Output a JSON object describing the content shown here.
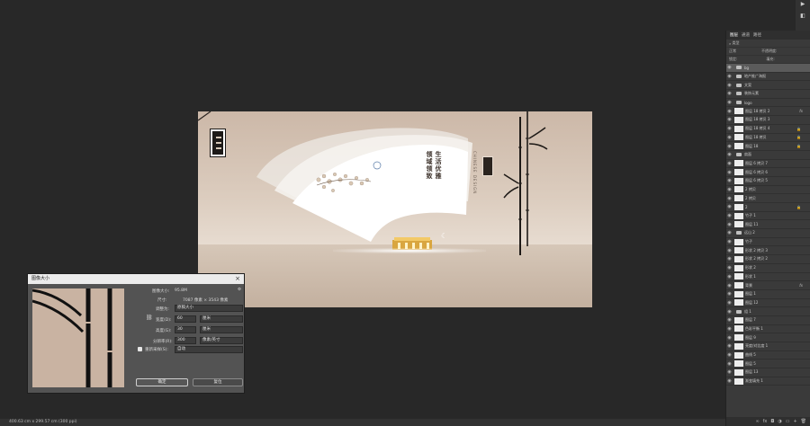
{
  "poster": {
    "seal_text": "华府",
    "headline": [
      "生活优雅",
      "领域领致"
    ],
    "side_text": "CHINESE DESIGN",
    "stamp_text": "府"
  },
  "dialog": {
    "title": "图像大小",
    "close": "×",
    "image_size_label": "图像大小:",
    "image_size_value": "95.8M",
    "dimensions_label": "尺寸:",
    "dimensions_value": "7087 像素 × 3543 像素",
    "fit_to_label": "调整为:",
    "fit_to_value": "原稿大小",
    "width_label": "宽度(D):",
    "width_value": "60",
    "width_unit": "厘米",
    "height_label": "高度(G):",
    "height_value": "30",
    "height_unit": "厘米",
    "resolution_label": "分辨率(R):",
    "resolution_value": "300",
    "resolution_unit": "像素/英寸",
    "resample_label": "重新采样(S):",
    "resample_value": "自动",
    "ok_label": "确定",
    "cancel_label": "复位"
  },
  "layers_panel": {
    "tabs": [
      "图层",
      "通道",
      "路径"
    ],
    "search_label": "类型",
    "blend_mode": "正常",
    "opacity_label": "不透明度:",
    "lock_label": "锁定:",
    "fill_label": "填充:",
    "layers": [
      {
        "name": "bg",
        "type": "folder",
        "sel": true
      },
      {
        "name": "地产推广海报",
        "type": "folder"
      },
      {
        "name": "文案",
        "type": "folder"
      },
      {
        "name": "装饰元素",
        "type": "folder"
      },
      {
        "name": "logo",
        "type": "folder"
      },
      {
        "name": "图层 18 拷贝 2",
        "type": "layer",
        "fx": true
      },
      {
        "name": "图层 18 拷贝 3",
        "type": "layer"
      },
      {
        "name": "图层 18 拷贝 4",
        "type": "layer",
        "lock": true
      },
      {
        "name": "图层 18 拷贝",
        "type": "layer",
        "lock": true
      },
      {
        "name": "图层 18",
        "type": "layer",
        "lock": true
      },
      {
        "name": "扇面",
        "type": "folder"
      },
      {
        "name": "图层 6 拷贝 7",
        "type": "layer"
      },
      {
        "name": "图层 6 拷贝 6",
        "type": "layer"
      },
      {
        "name": "图层 6 拷贝 5",
        "type": "layer"
      },
      {
        "name": "2 拷贝",
        "type": "layer"
      },
      {
        "name": "2 拷贝",
        "type": "layer"
      },
      {
        "name": "2",
        "type": "layer",
        "lock": true
      },
      {
        "name": "竹子 1",
        "type": "layer"
      },
      {
        "name": "图层 11",
        "type": "layer"
      },
      {
        "name": "远山 2",
        "type": "folder"
      },
      {
        "name": "竹子",
        "type": "layer"
      },
      {
        "name": "形状 2 拷贝 3",
        "type": "layer"
      },
      {
        "name": "形状 2 拷贝 2",
        "type": "layer"
      },
      {
        "name": "形状 2",
        "type": "layer"
      },
      {
        "name": "形状 1",
        "type": "layer"
      },
      {
        "name": "背景",
        "type": "layer",
        "fx": true
      },
      {
        "name": "图层 1",
        "type": "layer"
      },
      {
        "name": "图层 12",
        "type": "layer"
      },
      {
        "name": "组 1",
        "type": "folder"
      },
      {
        "name": "图层 7",
        "type": "layer"
      },
      {
        "name": "色彩平衡 1",
        "type": "layer"
      },
      {
        "name": "图层 9",
        "type": "layer"
      },
      {
        "name": "亮度/对比度 1",
        "type": "layer"
      },
      {
        "name": "曲线 5",
        "type": "layer"
      },
      {
        "name": "图层 5",
        "type": "layer"
      },
      {
        "name": "图层 13",
        "type": "layer"
      },
      {
        "name": "渐变填充 1",
        "type": "layer"
      }
    ]
  },
  "status_bar": {
    "text": "400.63 cm x 299.57 cm (300 ppi)"
  }
}
